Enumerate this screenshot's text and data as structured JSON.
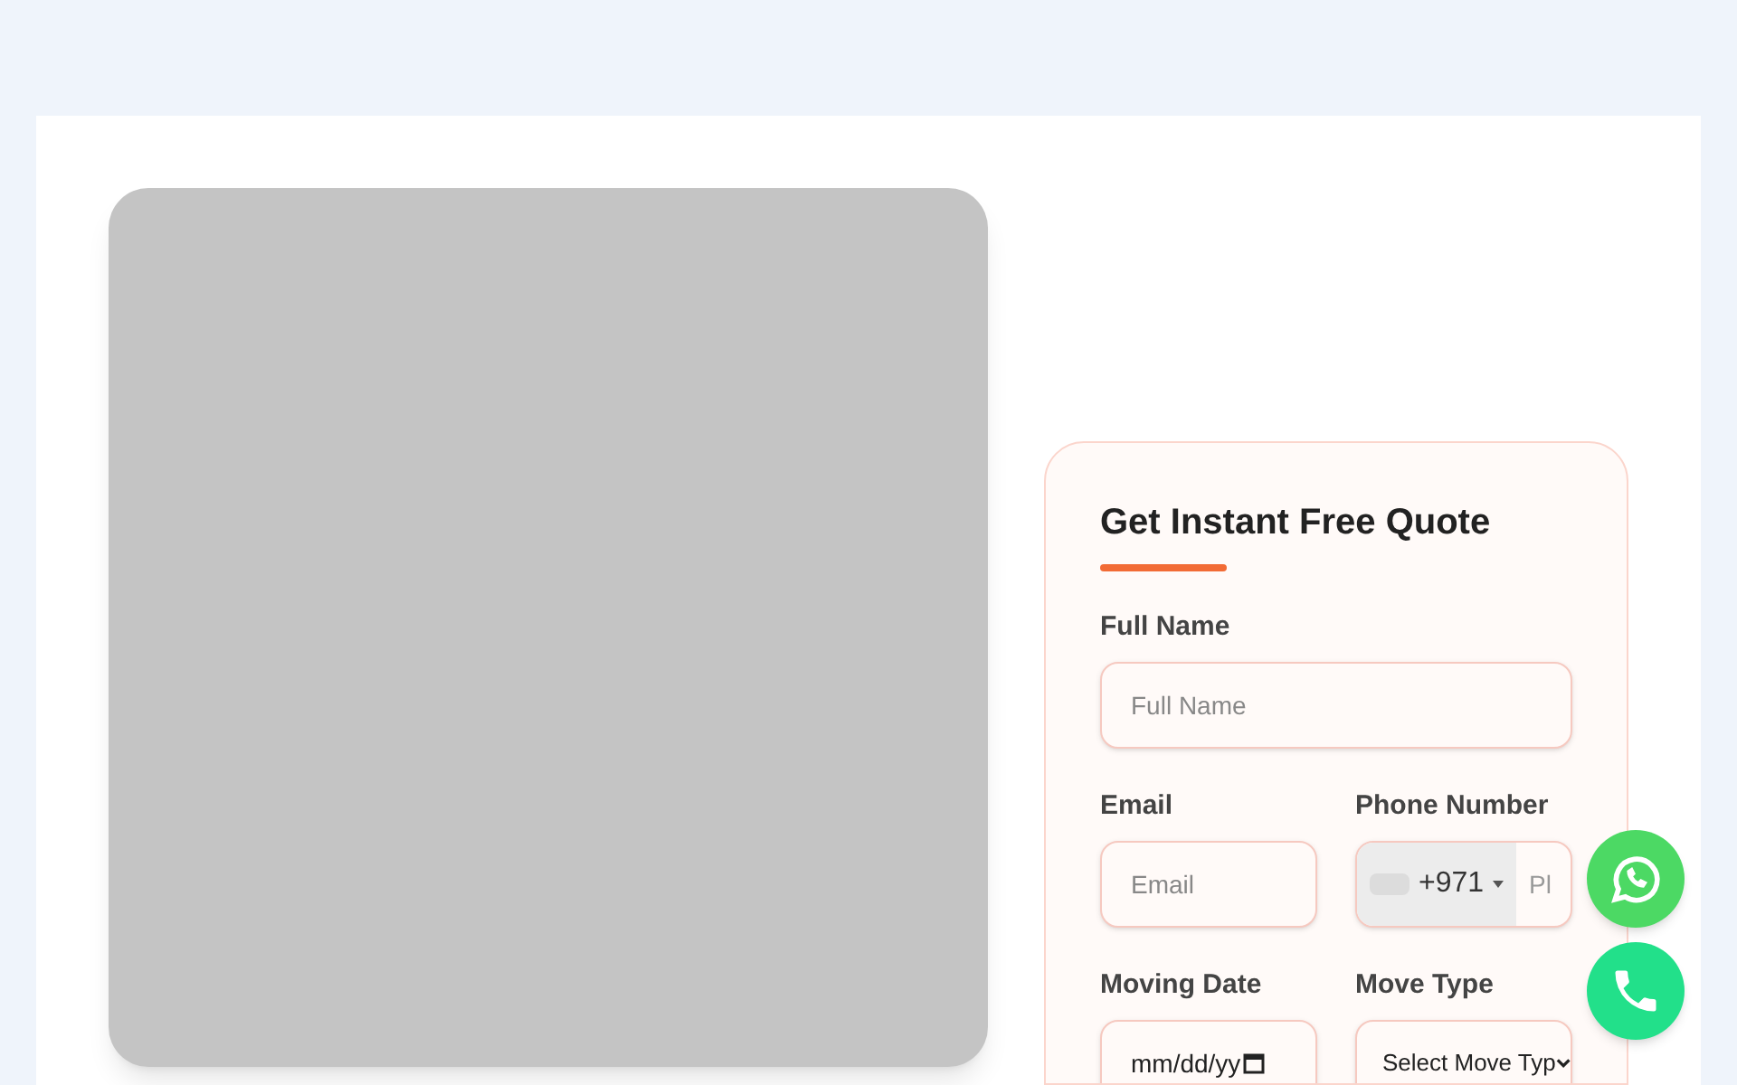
{
  "form": {
    "title": "Get Instant Free Quote",
    "fields": [
      {
        "kind": "text",
        "label": "Full Name",
        "placeholder": "Full Name"
      },
      {
        "kind": "text",
        "label": "Email",
        "placeholder": "Email"
      },
      {
        "kind": "phone",
        "label": "Phone Number",
        "code": "+971",
        "placeholder": "Pl"
      },
      {
        "kind": "date",
        "label": "Moving Date",
        "value": "mm/dd/yy"
      },
      {
        "kind": "select",
        "label": "Move Type",
        "value": "Select Move Typ"
      }
    ]
  }
}
